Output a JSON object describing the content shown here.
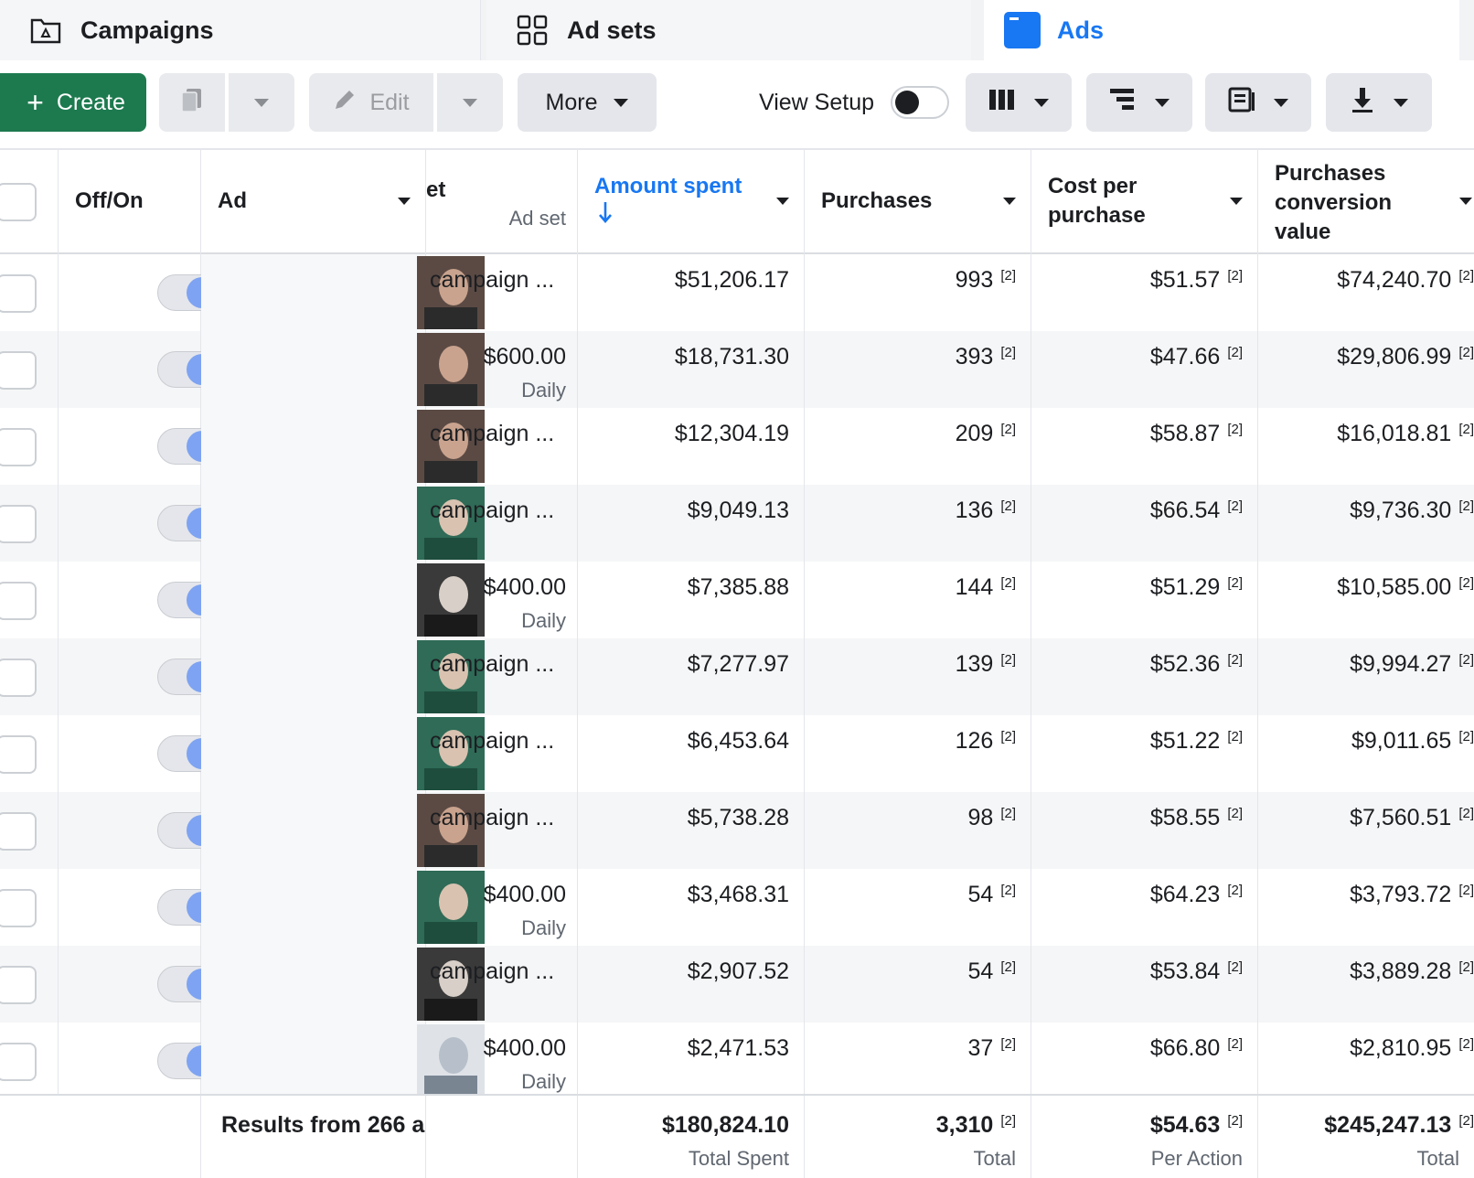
{
  "tabs": {
    "campaigns": "Campaigns",
    "adsets": "Ad sets",
    "ads": "Ads"
  },
  "toolbar": {
    "create": "Create",
    "edit": "Edit",
    "more": "More",
    "view_setup": "View Setup"
  },
  "columns": {
    "toggle": "Off/On",
    "ad": "Ad",
    "adset_partial": "et",
    "adset_sub": "Ad set",
    "amount_spent": "Amount spent",
    "purchases": "Purchases",
    "cost_per_purchase": [
      "Cost per",
      "purchase"
    ],
    "conversion_value": [
      "Purchases",
      "conversion",
      "value"
    ]
  },
  "ref_mark": "[2]",
  "rows": [
    {
      "budget": "campaign ...",
      "budget_sub": "",
      "spent": "$51,206.17",
      "purchases": "993",
      "cpp": "$51.57",
      "value": "$74,240.70"
    },
    {
      "budget": "$600.00",
      "budget_sub": "Daily",
      "spent": "$18,731.30",
      "purchases": "393",
      "cpp": "$47.66",
      "value": "$29,806.99"
    },
    {
      "budget": "campaign ...",
      "budget_sub": "",
      "spent": "$12,304.19",
      "purchases": "209",
      "cpp": "$58.87",
      "value": "$16,018.81"
    },
    {
      "budget": "campaign ...",
      "budget_sub": "",
      "spent": "$9,049.13",
      "purchases": "136",
      "cpp": "$66.54",
      "value": "$9,736.30"
    },
    {
      "budget": "$400.00",
      "budget_sub": "Daily",
      "spent": "$7,385.88",
      "purchases": "144",
      "cpp": "$51.29",
      "value": "$10,585.00"
    },
    {
      "budget": "campaign ...",
      "budget_sub": "",
      "spent": "$7,277.97",
      "purchases": "139",
      "cpp": "$52.36",
      "value": "$9,994.27"
    },
    {
      "budget": "campaign ...",
      "budget_sub": "",
      "spent": "$6,453.64",
      "purchases": "126",
      "cpp": "$51.22",
      "value": "$9,011.65"
    },
    {
      "budget": "campaign ...",
      "budget_sub": "",
      "spent": "$5,738.28",
      "purchases": "98",
      "cpp": "$58.55",
      "value": "$7,560.51"
    },
    {
      "budget": "$400.00",
      "budget_sub": "Daily",
      "spent": "$3,468.31",
      "purchases": "54",
      "cpp": "$64.23",
      "value": "$3,793.72"
    },
    {
      "budget": "campaign ...",
      "budget_sub": "",
      "spent": "$2,907.52",
      "purchases": "54",
      "cpp": "$53.84",
      "value": "$3,889.28"
    },
    {
      "budget": "$400.00",
      "budget_sub": "Daily",
      "spent": "$2,471.53",
      "purchases": "37",
      "cpp": "$66.80",
      "value": "$2,810.95"
    }
  ],
  "footer": {
    "results": "Results from 266 a",
    "spent": "$180,824.10",
    "spent_label": "Total Spent",
    "purchases": "3,310",
    "purchases_label": "Total",
    "cpp": "$54.63",
    "cpp_label": "Per Action",
    "value": "$245,247.13",
    "value_label": "Total"
  },
  "colors": {
    "create_button": "#1d7a4f",
    "active_tab": "#1877f2",
    "toggle_on": "#7ea3f2"
  },
  "icons": {
    "campaigns_tab": "folder-icon",
    "adsets_tab": "grid-icon",
    "ads_tab": "ad-icon",
    "duplicate": "duplicate-icon",
    "edit": "pencil-icon",
    "columns": "columns-icon",
    "breakdown": "breakdown-icon",
    "reports": "reports-icon",
    "export": "download-icon",
    "sort": "sort-down-arrow-icon"
  }
}
